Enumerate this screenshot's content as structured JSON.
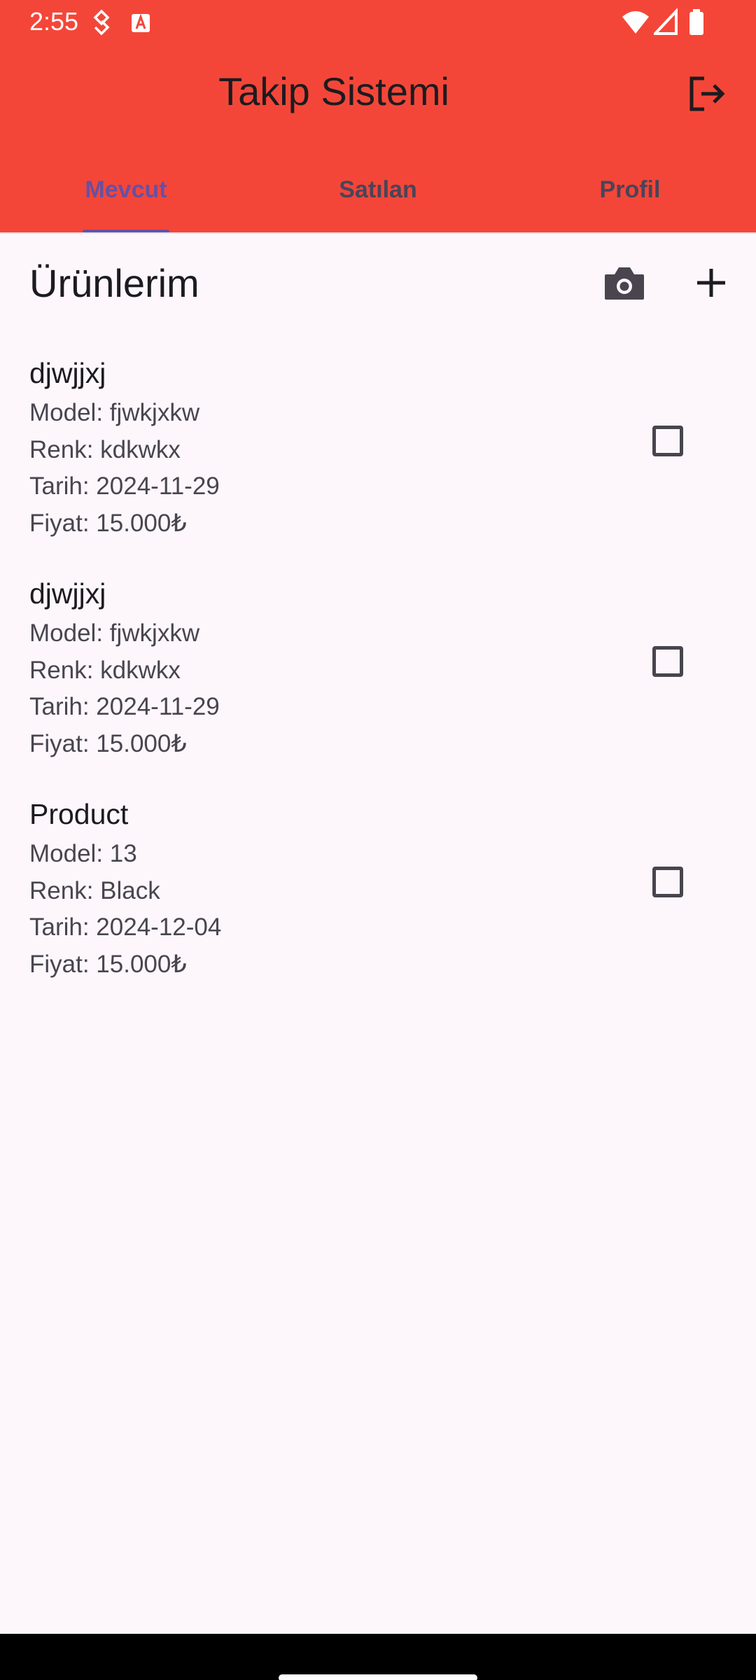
{
  "status_bar": {
    "time": "2:55",
    "left_icons": [
      "usb-debug-icon",
      "text-app-icon"
    ],
    "right_icons": [
      "wifi-icon",
      "signal-icon",
      "battery-icon"
    ]
  },
  "app_bar": {
    "title": "Takip Sistemi",
    "action_icon": "logout-icon",
    "background_color": "#F44638"
  },
  "tabs": [
    {
      "label": "Mevcut",
      "active": true
    },
    {
      "label": "Satılan",
      "active": false
    },
    {
      "label": "Profil",
      "active": false
    }
  ],
  "accent_color": "#6750A4",
  "section": {
    "title": "Ürünlerim",
    "actions": [
      "camera-icon",
      "add-icon"
    ]
  },
  "products": [
    {
      "name": "djwjjxj",
      "model": "Model: fjwkjxkw",
      "color": "Renk: kdkwkx",
      "date": "Tarih: 2024-11-29",
      "price": "Fiyat: 15.000₺",
      "checked": false
    },
    {
      "name": "djwjjxj",
      "model": "Model: fjwkjxkw",
      "color": "Renk: kdkwkx",
      "date": "Tarih: 2024-11-29",
      "price": "Fiyat: 15.000₺",
      "checked": false
    },
    {
      "name": "Product",
      "model": "Model: 13",
      "color": "Renk: Black",
      "date": "Tarih: 2024-12-04",
      "price": "Fiyat: 15.000₺",
      "checked": false
    }
  ]
}
